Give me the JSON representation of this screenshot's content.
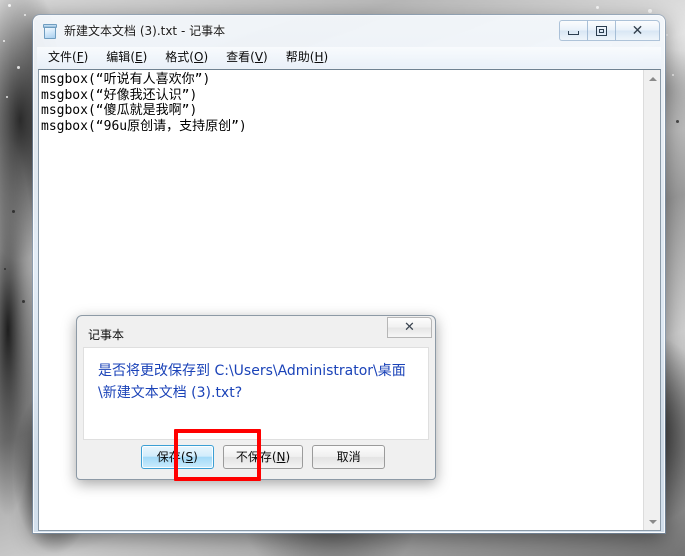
{
  "desktop": {
    "wallpaper_description": "grayscale abstract photo"
  },
  "window": {
    "title": "新建文本文档 (3).txt - 记事本",
    "icon": "notepad-icon",
    "controls": {
      "minimize": "–",
      "maximize": "□",
      "close": "✕"
    },
    "menubar": [
      {
        "label": "文件",
        "mnemonic": "F"
      },
      {
        "label": "编辑",
        "mnemonic": "E"
      },
      {
        "label": "格式",
        "mnemonic": "O"
      },
      {
        "label": "查看",
        "mnemonic": "V"
      },
      {
        "label": "帮助",
        "mnemonic": "H"
      }
    ],
    "editor": {
      "content": "msgbox(“听说有人喜欢你”)\nmsgbox(“好像我还认识”)\nmsgbox(“傻瓜就是我啊”)\nmsgbox(“96u原创请，支持原创”)",
      "lines": [
        "msgbox(“听说有人喜欢你”)",
        "msgbox(“好像我还认识”)",
        "msgbox(“傻瓜就是我啊”)",
        "msgbox(“96u原创请，支持原创”)"
      ]
    },
    "scrollbar": {
      "up_arrow": "▲",
      "down_arrow": "▼"
    }
  },
  "dialog": {
    "title": "记事本",
    "close_glyph": "✕",
    "message": "是否将更改保存到 C:\\Users\\Administrator\\桌面\\新建文本文档 (3).txt?",
    "message_color": "#1b43b8",
    "buttons": [
      {
        "label": "保存",
        "mnemonic": "S",
        "default": true,
        "name": "save-button"
      },
      {
        "label": "不保存",
        "mnemonic": "N",
        "default": false,
        "name": "dont-save-button"
      },
      {
        "label": "取消",
        "mnemonic": "",
        "default": false,
        "name": "cancel-button"
      }
    ]
  },
  "annotation": {
    "type": "red-rectangle-highlight",
    "target": "save-button",
    "color": "#ff0000"
  }
}
